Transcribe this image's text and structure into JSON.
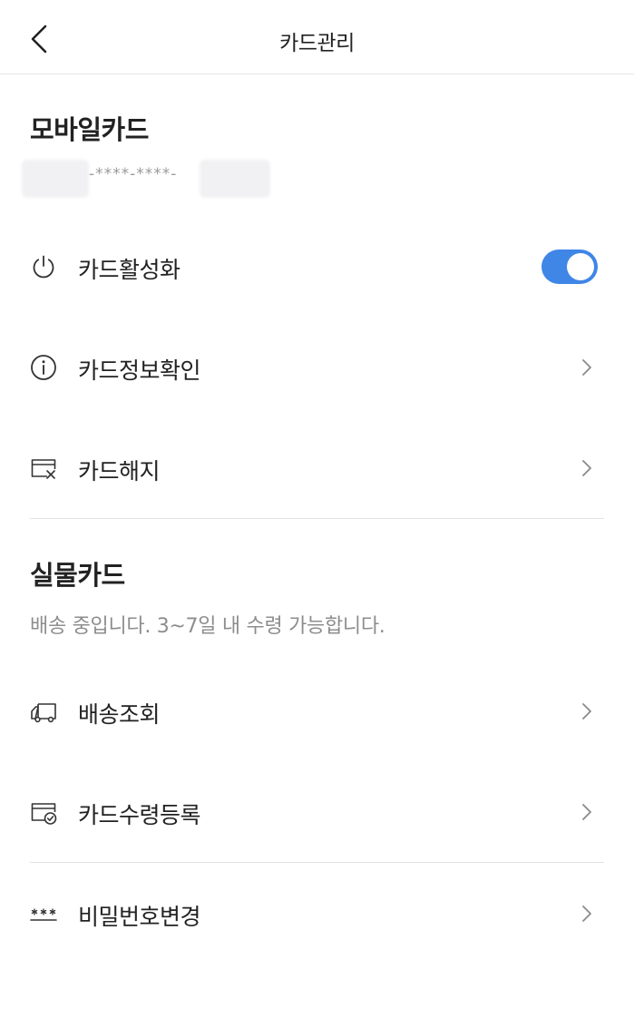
{
  "header": {
    "title": "카드관리"
  },
  "mobile_card": {
    "title": "모바일카드",
    "masked_number": "-****-****-",
    "items": [
      {
        "label": "카드활성화",
        "icon": "power-icon",
        "control": "toggle",
        "toggle_on": true
      },
      {
        "label": "카드정보확인",
        "icon": "info-icon",
        "control": "chevron"
      },
      {
        "label": "카드해지",
        "icon": "card-cancel-icon",
        "control": "chevron"
      }
    ]
  },
  "physical_card": {
    "title": "실물카드",
    "status": "배송 중입니다. 3~7일 내 수령 가능합니다.",
    "items": [
      {
        "label": "배송조회",
        "icon": "truck-icon",
        "control": "chevron"
      },
      {
        "label": "카드수령등록",
        "icon": "card-check-icon",
        "control": "chevron"
      }
    ]
  },
  "password": {
    "items": [
      {
        "label": "비밀번호변경",
        "icon": "password-icon",
        "control": "chevron"
      }
    ]
  },
  "colors": {
    "toggle_on": "#3f86e6",
    "divider": "#e3e3e3",
    "subtext": "#8d8d8d",
    "text": "#222222"
  }
}
